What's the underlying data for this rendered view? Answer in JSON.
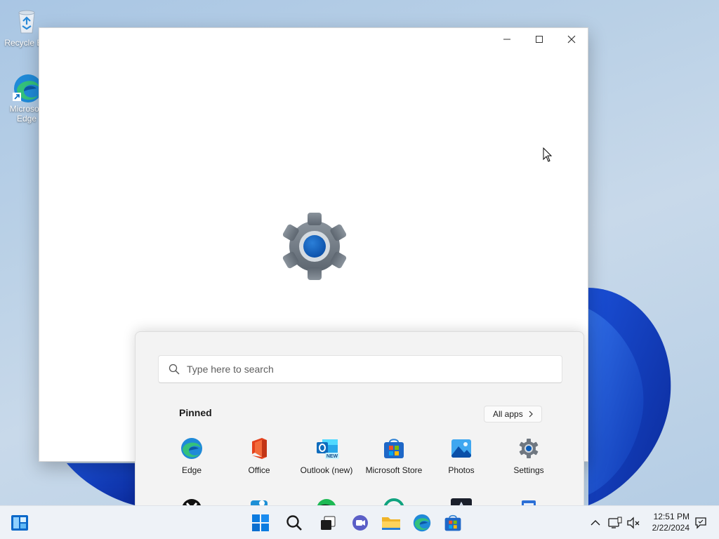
{
  "desktop": {
    "icons": [
      {
        "label": "Recycle Bin",
        "icon": "recycle-bin-icon"
      },
      {
        "label": "Microsoft Edge",
        "icon": "edge-icon"
      }
    ]
  },
  "window": {
    "controls": [
      "minimize",
      "maximize",
      "close"
    ],
    "splash_icon": "settings-gear-icon"
  },
  "start_menu": {
    "search_placeholder": "Type here to search",
    "pinned_title": "Pinned",
    "all_apps_label": "All apps",
    "pinned_apps": [
      {
        "label": "Edge",
        "icon": "edge-icon"
      },
      {
        "label": "Office",
        "icon": "office-icon"
      },
      {
        "label": "Outlook (new)",
        "icon": "outlook-icon",
        "badge": "NEW"
      },
      {
        "label": "Microsoft Store",
        "icon": "store-icon"
      },
      {
        "label": "Photos",
        "icon": "photos-icon"
      },
      {
        "label": "Settings",
        "icon": "settings-icon"
      }
    ],
    "second_row_icons": [
      "xbox-icon",
      "clipchamp-icon",
      "spotify-icon",
      "copilot-icon",
      "prime-video-icon",
      "notepad-icon"
    ]
  },
  "taskbar": {
    "items": [
      "start-icon",
      "search-icon",
      "task-view-icon",
      "chat-icon",
      "file-explorer-icon",
      "edge-icon",
      "store-icon"
    ],
    "left_widget": "widgets-icon",
    "time": "12:51 PM",
    "date": "2/22/2024"
  },
  "colors": {
    "accent": "#0067c0",
    "windows_blue": "#0a5bd8"
  }
}
